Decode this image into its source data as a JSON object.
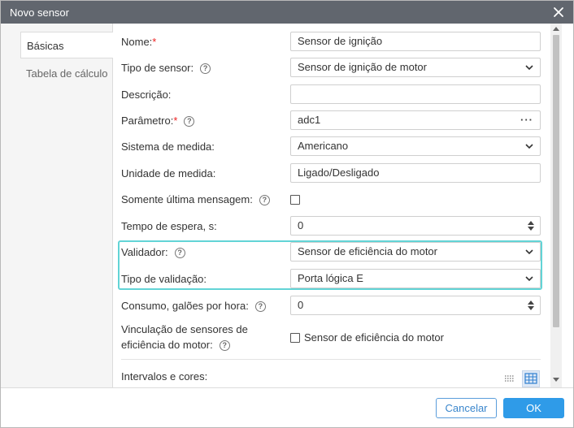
{
  "dialog": {
    "title": "Novo sensor",
    "close_icon": "close-icon"
  },
  "tabs": [
    {
      "label": "Básicas",
      "active": true
    },
    {
      "label": "Tabela de cálculo",
      "active": false
    }
  ],
  "form": {
    "nome": {
      "label": "Nome:",
      "required": "*",
      "value": "Sensor de ignição"
    },
    "tipo_sensor": {
      "label": "Tipo de sensor:",
      "value": "Sensor de ignição de motor"
    },
    "descricao": {
      "label": "Descrição:",
      "value": ""
    },
    "parametro": {
      "label": "Parâmetro:",
      "required": "*",
      "value": "adc1",
      "more": "···"
    },
    "sistema_medida": {
      "label": "Sistema de medida:",
      "value": "Americano"
    },
    "unidade_medida": {
      "label": "Unidade de medida:",
      "value": "Ligado/Desligado"
    },
    "somente_ultima": {
      "label": "Somente última mensagem:",
      "checked": false
    },
    "tempo_espera": {
      "label": "Tempo de espera, s:",
      "value": "0"
    },
    "validador": {
      "label": "Validador:",
      "value": "Sensor de eficiência do motor"
    },
    "tipo_validacao": {
      "label": "Tipo de validação:",
      "value": "Porta lógica E"
    },
    "consumo": {
      "label": "Consumo, galões por hora:",
      "value": "0"
    },
    "vinculacao": {
      "label_line1": "Vinculação de sensores de",
      "label_line2": "eficiência do motor:",
      "option_label": "Sensor de eficiência do motor",
      "checked": false
    },
    "intervalos": {
      "label": "Intervalos e cores:"
    }
  },
  "help_icon": "?",
  "footer": {
    "cancel_label": "Cancelar",
    "ok_label": "OK"
  },
  "colors": {
    "titlebar": "#61666e",
    "highlight_border": "#62d4d6",
    "required": "#ee2222",
    "ok_button": "#2f9be8"
  }
}
